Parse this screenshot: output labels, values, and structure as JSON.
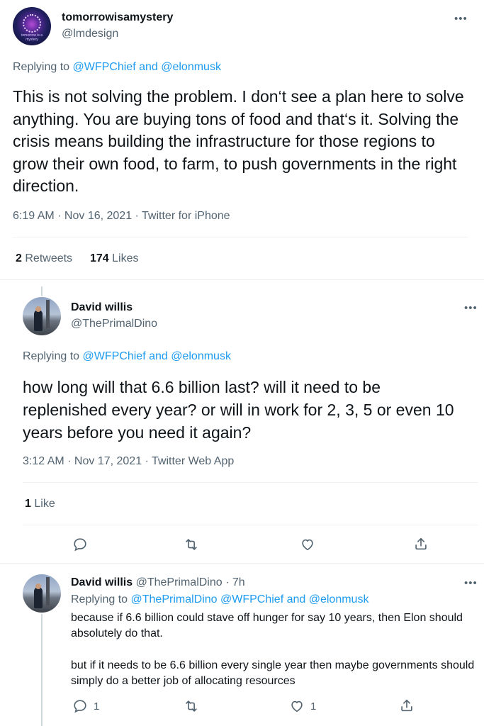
{
  "tweet1": {
    "display_name": "tomorrowisamystery",
    "handle": "@lmdesign",
    "avatar_caption": "tomorrow is a mystery",
    "replying_prefix": "Replying to",
    "replying_to": "@WFPChief and @elonmusk",
    "text": "This is not solving the problem. I don‘t see a plan here to solve anything. You are buying tons of food and that‘s it. Solving the crisis means building the infrastructure for those regions to grow their own food, to farm, to push governments in the right direction.",
    "meta": "6:19 AM · Nov 16, 2021 · Twitter for iPhone",
    "retweets_count": "2",
    "retweets_label": "Retweets",
    "likes_count": "174",
    "likes_label": "Likes"
  },
  "tweet2": {
    "display_name": "David willis",
    "handle": "@ThePrimalDino",
    "replying_prefix": "Replying to",
    "replying_to": "@WFPChief and @elonmusk",
    "text": "how long will that 6.6 billion last? will it need to be replenished every year? or will in work for 2, 3, 5 or even 10 years before you need it again?",
    "meta": "3:12 AM · Nov 17, 2021 · Twitter Web App",
    "likes_count": "1",
    "likes_label": "Like"
  },
  "tweet3": {
    "display_name": "David willis",
    "handle_time": "@ThePrimalDino · 7h",
    "replying_prefix": "Replying to",
    "replying_to": "@ThePrimalDino @WFPChief and @elonmusk",
    "paragraph1": "because if 6.6 billion could stave off hunger for say 10 years, then Elon should absolutely do that.",
    "paragraph2": "but if it needs to be 6.6 billion every single year then maybe governments should simply do a better job of allocating resources",
    "reply_count": "1",
    "like_count": "1"
  },
  "icons": {
    "more": "more-horizontal-icon",
    "reply": "reply-icon",
    "retweet": "retweet-icon",
    "like": "heart-icon",
    "share": "share-icon"
  },
  "colors": {
    "accent": "#1d9bf0",
    "muted": "#536471",
    "text": "#0f1419",
    "divider": "#eff3f4"
  }
}
